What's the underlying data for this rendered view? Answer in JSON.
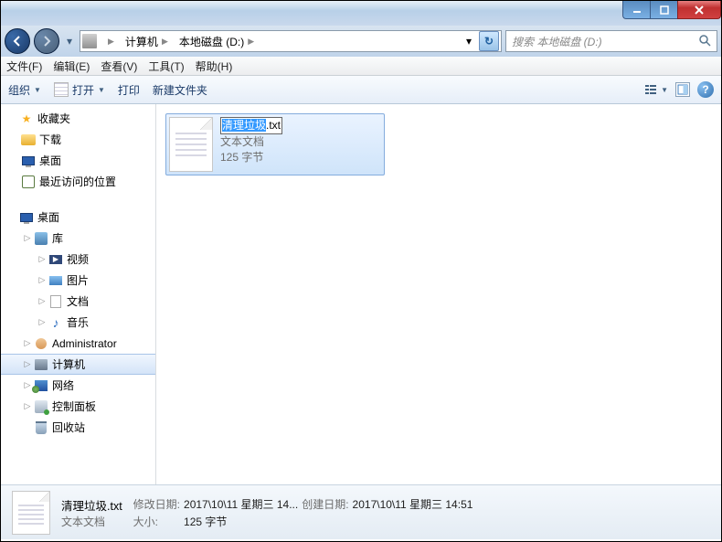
{
  "nav": {
    "dropdown": "▾"
  },
  "breadcrumb": {
    "root": "计算机",
    "cur": "本地磁盘 (D:)",
    "sep": "▶"
  },
  "search": {
    "placeholder": "搜索 本地磁盘 (D:)"
  },
  "menu": {
    "file": "文件(F)",
    "edit": "编辑(E)",
    "view": "查看(V)",
    "tools": "工具(T)",
    "help": "帮助(H)"
  },
  "toolbar": {
    "organize": "组织",
    "open": "打开",
    "print": "打印",
    "newfolder": "新建文件夹",
    "drop": "▼",
    "help": "?"
  },
  "tree": {
    "fav": "收藏夹",
    "downloads": "下载",
    "desktop": "桌面",
    "recent": "最近访问的位置",
    "desk": "桌面",
    "libs": "库",
    "vid": "视频",
    "pic": "图片",
    "doc": "文档",
    "music": "音乐",
    "admin": "Administrator",
    "pc": "计算机",
    "net": "网络",
    "ctrl": "控制面板",
    "recycle": "回收站"
  },
  "item": {
    "name_sel": "清理垃圾",
    "name_suf": ".txt",
    "type": "文本文档",
    "size": "125 字节"
  },
  "details": {
    "name": "清理垃圾.txt",
    "type": "文本文档",
    "modLbl": "修改日期:",
    "mod": "2017\\10\\11 星期三 14...",
    "createLbl": "创建日期:",
    "create": "2017\\10\\11 星期三 14:51",
    "sizeLbl": "大小:",
    "size": "125 字节"
  }
}
